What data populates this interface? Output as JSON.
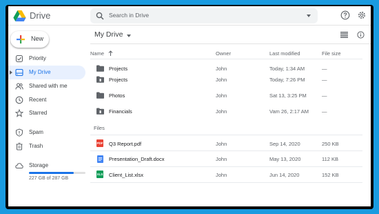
{
  "app": {
    "title": "Drive"
  },
  "search": {
    "placeholder": "Search in Drive"
  },
  "new_button": {
    "label": "New"
  },
  "sidebar": {
    "items": [
      {
        "label": "Priority",
        "icon": "priority-icon"
      },
      {
        "label": "My Drive",
        "icon": "my-drive-icon",
        "active": true
      },
      {
        "label": "Shared with me",
        "icon": "shared-icon"
      },
      {
        "label": "Recent",
        "icon": "clock-icon"
      },
      {
        "label": "Starred",
        "icon": "star-icon"
      },
      {
        "label": "Spam",
        "icon": "spam-icon"
      },
      {
        "label": "Trash",
        "icon": "trash-icon"
      },
      {
        "label": "Storage",
        "icon": "cloud-icon"
      }
    ],
    "storage": {
      "text": "227 GB of 287 GB",
      "used_fraction": 0.79
    }
  },
  "main": {
    "breadcrumb": "My Drive",
    "columns": {
      "name": "Name",
      "owner": "Owner",
      "modified": "Last modified",
      "size": "File size"
    },
    "folders": [
      {
        "name": "Projects",
        "owner": "John",
        "modified": "Today, 1:34 AM",
        "size": "—",
        "icon": "folder-icon"
      },
      {
        "name": "Projects",
        "owner": "John",
        "modified": "Today, 7:26 PM",
        "size": "—",
        "icon": "shared-folder-icon"
      },
      {
        "name": "Photos",
        "owner": "John",
        "modified": "Sat 13, 3:25 PM",
        "size": "—",
        "icon": "folder-icon"
      },
      {
        "name": "Financials",
        "owner": "John",
        "modified": "Vam 26, 2:17 AM",
        "size": "—",
        "icon": "shared-folder-icon"
      }
    ],
    "files_label": "Files",
    "files": [
      {
        "name": "Q3 Report.pdf",
        "owner": "John",
        "modified": "Sep 14, 2020",
        "size": "250 KB",
        "icon": "pdf-icon",
        "tag": "PDF",
        "color": "#ea4335"
      },
      {
        "name": "Presentation_Draft.docx",
        "owner": "John",
        "modified": "May 13, 2020",
        "size": "112 KB",
        "icon": "doc-icon",
        "tag": "",
        "color": "#4285f4"
      },
      {
        "name": "Client_List.xlsx",
        "owner": "John",
        "modified": "Jun 14, 2020",
        "size": "152 KB",
        "icon": "sheet-icon",
        "tag": "XLS",
        "color": "#0f9d58"
      }
    ]
  }
}
